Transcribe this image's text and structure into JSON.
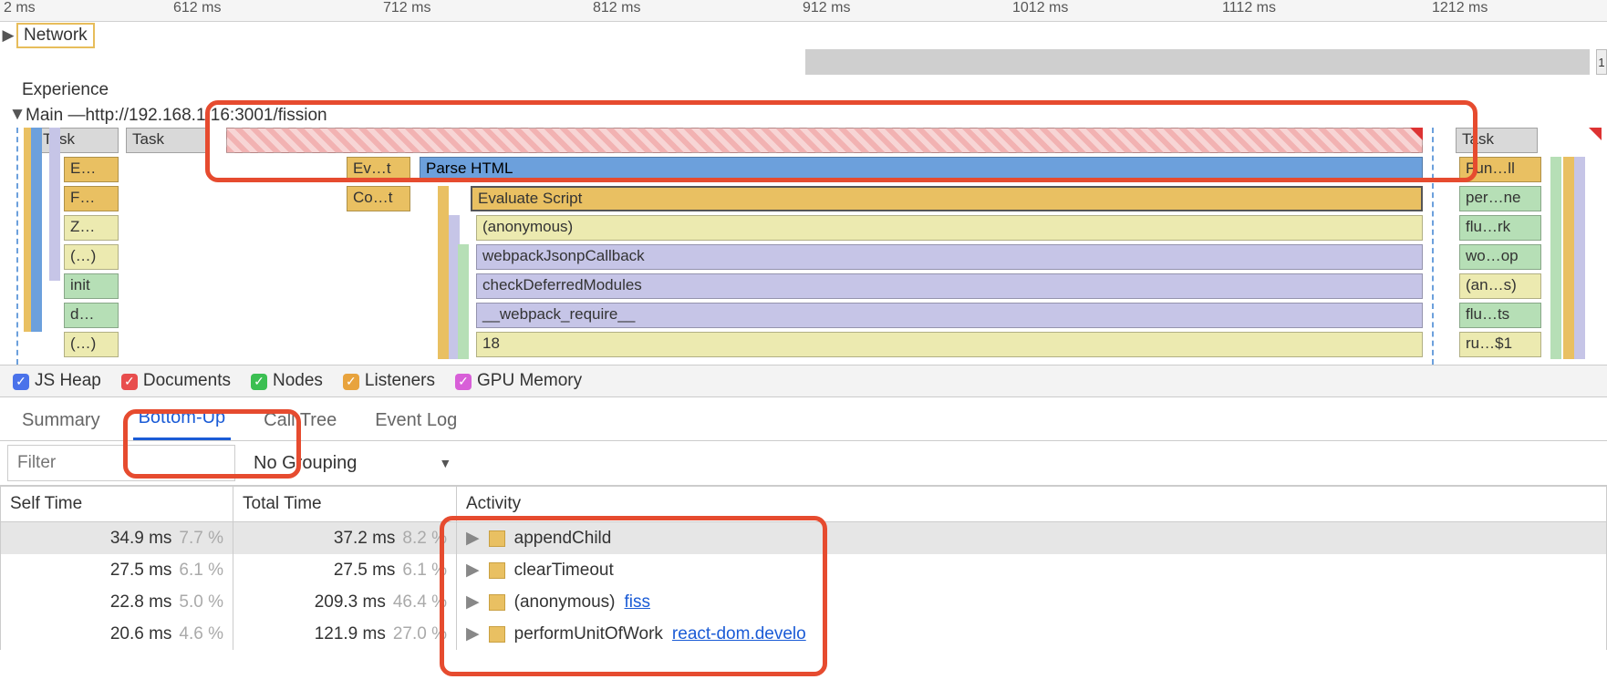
{
  "ruler": {
    "ticks": [
      "2 ms",
      "612 ms",
      "712 ms",
      "812 ms",
      "912 ms",
      "1012 ms",
      "1112 ms",
      "1212 ms"
    ]
  },
  "tracks": {
    "network": {
      "label": "Network",
      "tail": "1"
    },
    "experience": {
      "label": "Experience"
    },
    "main": {
      "prefix": "Main — ",
      "url": "http://192.168.1.16:3001/fission"
    }
  },
  "flame": {
    "tasks": {
      "t1": "Task",
      "t2": "Task",
      "t3": "Task"
    },
    "left_stack": [
      "E…",
      "F…",
      "Z…",
      "(…)",
      "init",
      "d…",
      "(…)"
    ],
    "mid_top": {
      "ev": "Ev…t",
      "co": "Co…t"
    },
    "center": {
      "parse": "Parse HTML",
      "eval": "Evaluate Script",
      "anon": "(anonymous)",
      "wjc": "webpackJsonpCallback",
      "cdm": "checkDeferredModules",
      "wr": "__webpack_require__",
      "n18": "18"
    },
    "right_stack": [
      "Fun…ll",
      "per…ne",
      "flu…rk",
      "wo…op",
      "(an…s)",
      "flu…ts",
      "ru…$1"
    ]
  },
  "memory": {
    "items": [
      {
        "color": "blue-c",
        "label": "JS Heap"
      },
      {
        "color": "red-c",
        "label": "Documents"
      },
      {
        "color": "green-c",
        "label": "Nodes"
      },
      {
        "color": "gold-c",
        "label": "Listeners"
      },
      {
        "color": "mag-c",
        "label": "GPU Memory"
      }
    ]
  },
  "tabs": {
    "summary": "Summary",
    "bottom_up": "Bottom-Up",
    "call_tree": "Call Tree",
    "event_log": "Event Log"
  },
  "filter": {
    "placeholder": "Filter",
    "grouping": "No Grouping"
  },
  "table": {
    "headers": {
      "self": "Self Time",
      "total": "Total Time",
      "activity": "Activity"
    },
    "rows": [
      {
        "self_ms": "34.9 ms",
        "self_pct": "7.7 %",
        "self_fill": 34,
        "total_ms": "37.2 ms",
        "total_pct": "8.2 %",
        "total_fill": 12,
        "activity": "appendChild",
        "link": "",
        "selected": true
      },
      {
        "self_ms": "27.5 ms",
        "self_pct": "6.1 %",
        "self_fill": 27,
        "total_ms": "27.5 ms",
        "total_pct": "6.1 %",
        "total_fill": 9,
        "activity": "clearTimeout",
        "link": ""
      },
      {
        "self_ms": "22.8 ms",
        "self_pct": "5.0 %",
        "self_fill": 22,
        "total_ms": "209.3 ms",
        "total_pct": "46.4 %",
        "total_fill": 68,
        "activity": "(anonymous)",
        "link": "fiss"
      },
      {
        "self_ms": "20.6 ms",
        "self_pct": "4.6 %",
        "self_fill": 20,
        "total_ms": "121.9 ms",
        "total_pct": "27.0 %",
        "total_fill": 40,
        "activity": "performUnitOfWork",
        "link": "react-dom.develo"
      }
    ]
  }
}
